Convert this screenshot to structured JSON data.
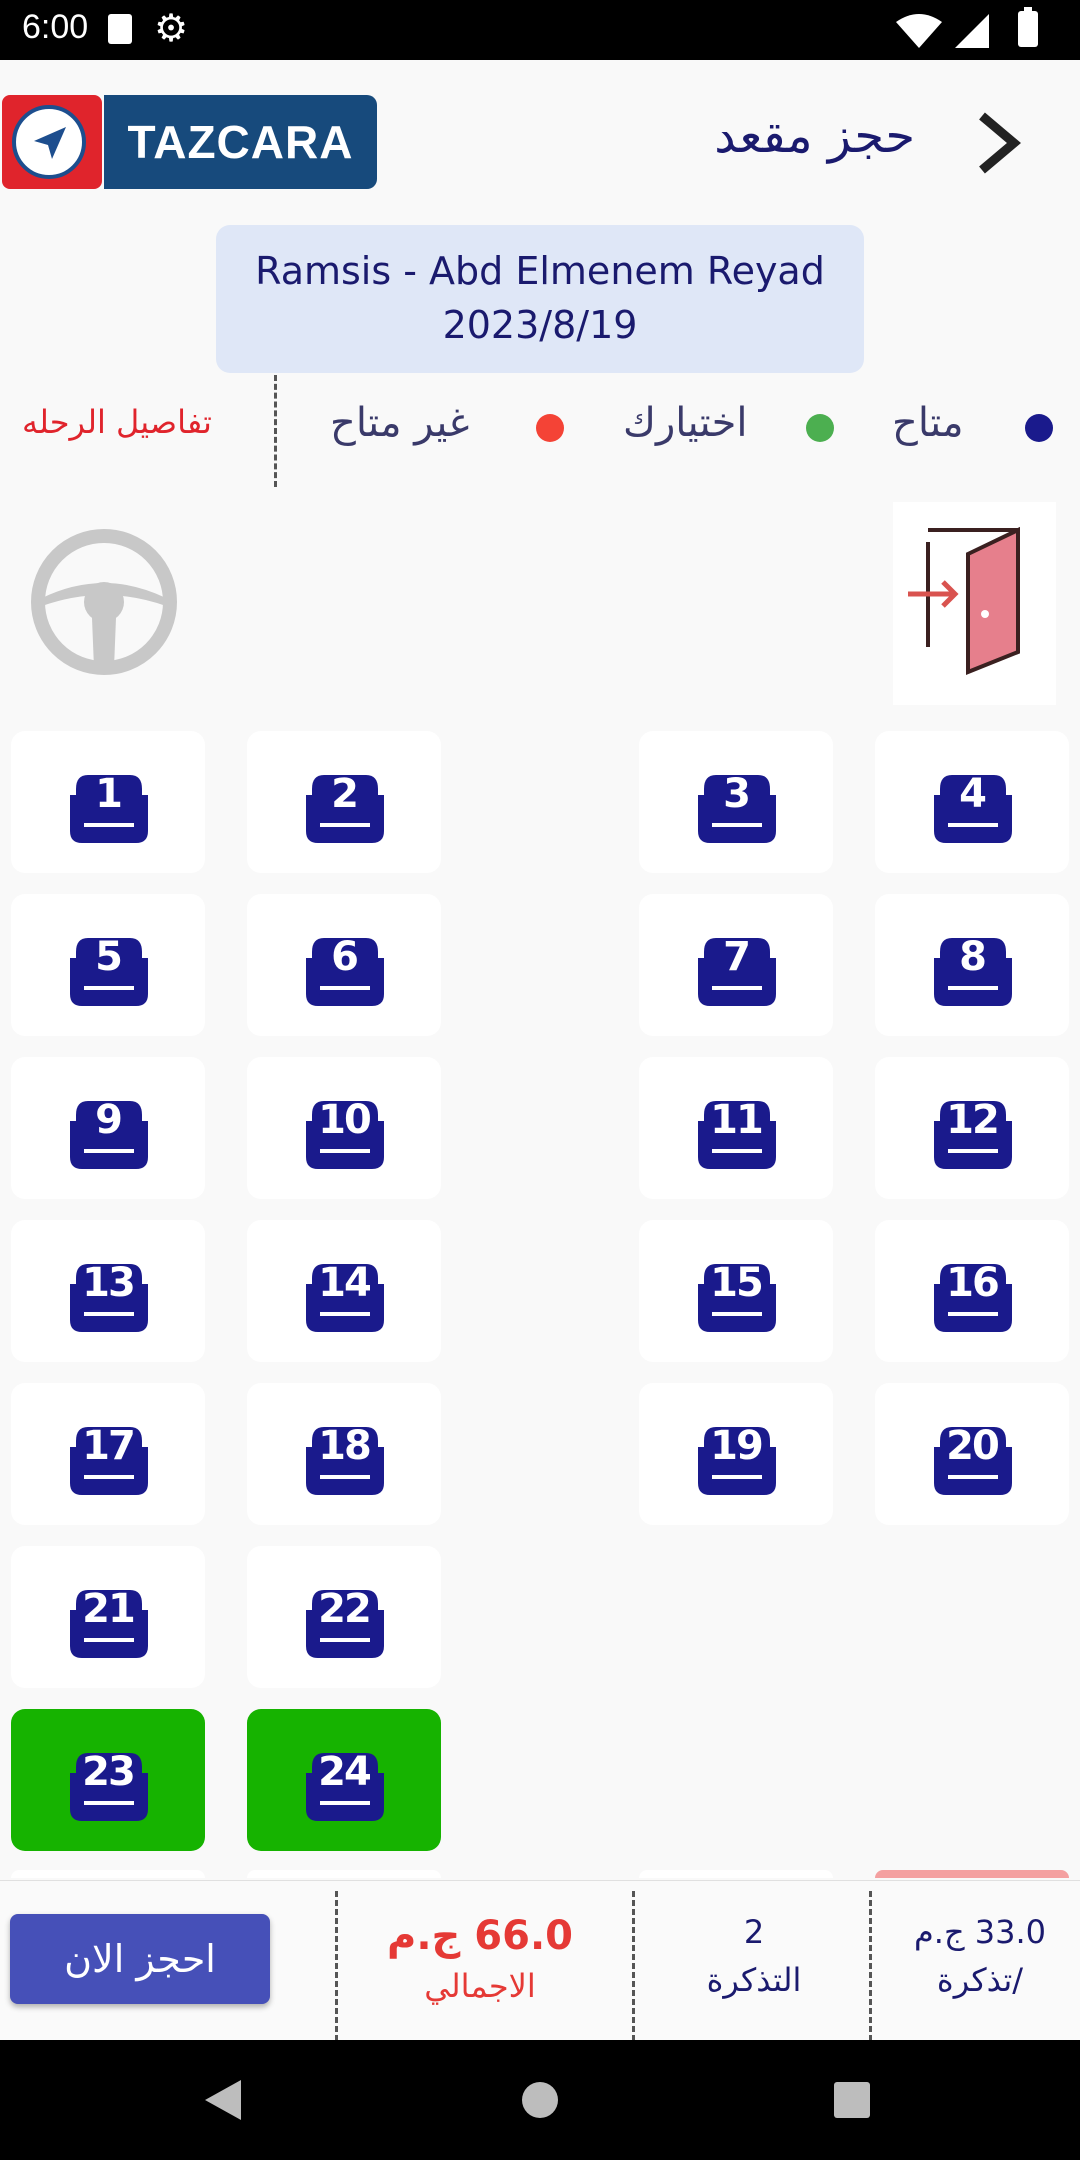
{
  "status_bar": {
    "time": "6:00"
  },
  "header": {
    "logo_text": "TAZCARA",
    "title": "حجز مقعد"
  },
  "trip": {
    "route": "Ramsis - Abd Elmenem Reyad",
    "date": "2023/8/19"
  },
  "legend": {
    "trip_details": "تفاصيل الرحله",
    "available": {
      "label": "متاح",
      "color": "#1a1a8c"
    },
    "selected": {
      "label": "اختيارك",
      "color": "#4caf50"
    },
    "unavailable": {
      "label": "غير متاح",
      "color": "#f44336"
    }
  },
  "seats": [
    {
      "number": "1",
      "status": "available"
    },
    {
      "number": "2",
      "status": "available"
    },
    {
      "number": "3",
      "status": "available"
    },
    {
      "number": "4",
      "status": "available"
    },
    {
      "number": "5",
      "status": "available"
    },
    {
      "number": "6",
      "status": "available"
    },
    {
      "number": "7",
      "status": "available"
    },
    {
      "number": "8",
      "status": "available"
    },
    {
      "number": "9",
      "status": "available"
    },
    {
      "number": "10",
      "status": "available"
    },
    {
      "number": "11",
      "status": "available"
    },
    {
      "number": "12",
      "status": "available"
    },
    {
      "number": "13",
      "status": "available"
    },
    {
      "number": "14",
      "status": "available"
    },
    {
      "number": "15",
      "status": "available"
    },
    {
      "number": "16",
      "status": "available"
    },
    {
      "number": "17",
      "status": "available"
    },
    {
      "number": "18",
      "status": "available"
    },
    {
      "number": "19",
      "status": "available"
    },
    {
      "number": "20",
      "status": "available"
    },
    {
      "number": "21",
      "status": "available"
    },
    {
      "number": "22",
      "status": "available"
    },
    {
      "number": "23",
      "status": "selected"
    },
    {
      "number": "24",
      "status": "selected"
    }
  ],
  "summary": {
    "book_button": "احجز الان",
    "total_value": "66.0 ج.م",
    "total_label": "الاجمالي",
    "ticket_count": "2",
    "ticket_label": "التذكرة",
    "price_value": "33.0 ج.م",
    "price_label": "/تذكرة"
  },
  "colors": {
    "accent": "#1a1a8c",
    "selected": "#16b300",
    "brand_red": "#e0242c",
    "brand_blue": "#174a7c"
  }
}
